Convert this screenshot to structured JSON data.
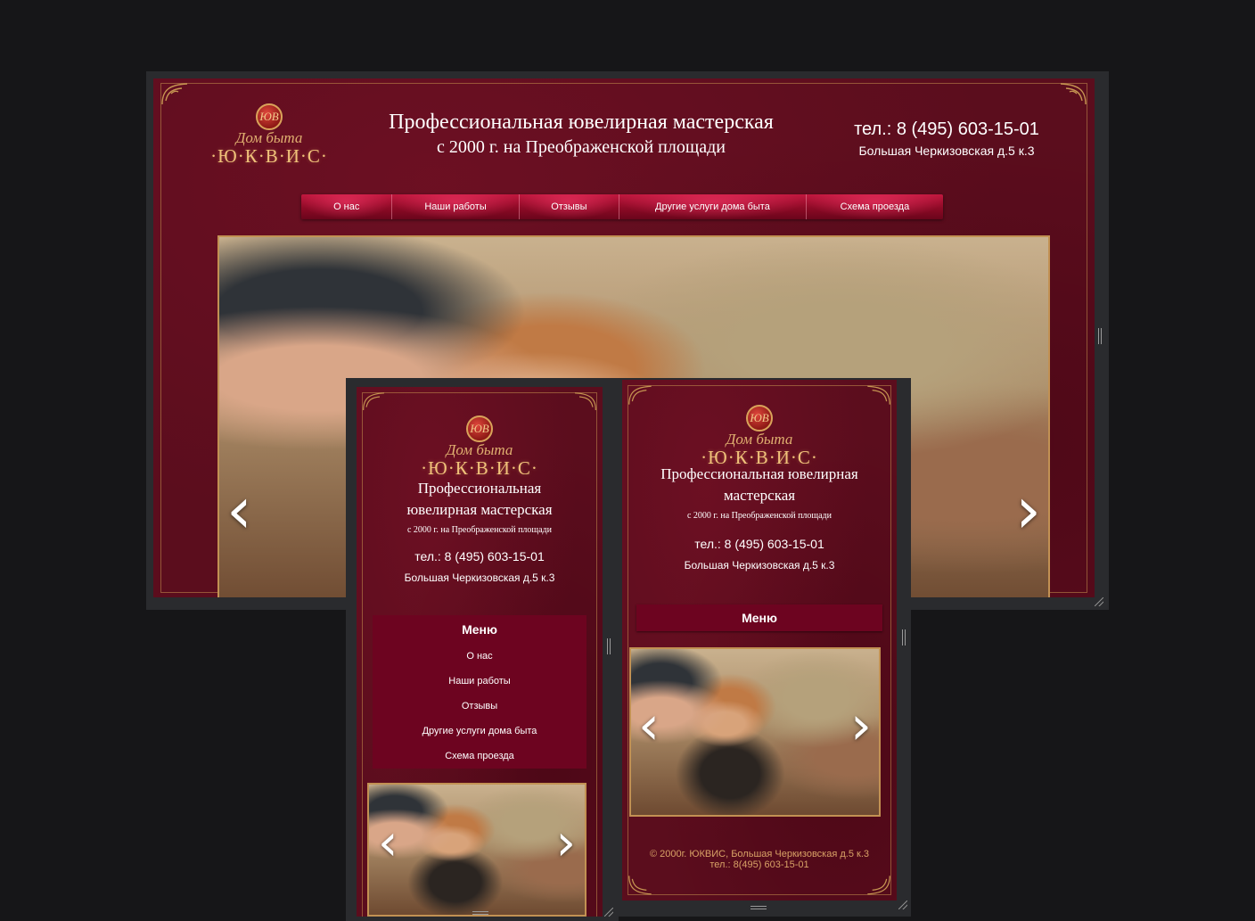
{
  "logo": {
    "emblem": "ЮВ",
    "script": "Дом быта",
    "brand": "·Ю·К·В·И·С·"
  },
  "desktop": {
    "title_line1": "Профессиональная ювелирная мастерская",
    "title_line2": "с 2000 г. на Преображенской площади",
    "phone": "тел.: 8 (495) 603-15-01",
    "address": "Большая Черкизовская д.5 к.3",
    "nav": [
      "О нас",
      "Наши работы",
      "Отзывы",
      "Другие услуги дома быта",
      "Схема проезда"
    ],
    "arrow_prev": "‹",
    "arrow_next": "›"
  },
  "mobile_narrow": {
    "title": "Профессиональная ювелирная мастерская",
    "subtitle": "с 2000 г. на Преображенской площади",
    "phone": "тел.: 8 (495) 603-15-01",
    "address": "Большая Черкизовская д.5 к.3",
    "menu_title": "Меню",
    "menu_items": [
      "О нас",
      "Наши работы",
      "Отзывы",
      "Другие услуги дома быта",
      "Схема проезда"
    ],
    "arrow_prev": "‹",
    "arrow_next": "›"
  },
  "mobile_wide": {
    "title": "Профессиональная ювелирная мастерская",
    "subtitle": "с 2000 г. на Преображенской площади",
    "phone": "тел.: 8 (495) 603-15-01",
    "address": "Большая Черкизовская д.5 к.3",
    "menu_button": "Меню",
    "arrow_prev": "‹",
    "arrow_next": "›",
    "footer_line1": "© 2000г. ЮКВИС, Большая Черкизовская д.5 к.3",
    "footer_line2": "тел.: 8(495) 603-15-01"
  },
  "colors": {
    "background": "#161618",
    "page": "#5b0d1d",
    "menu": "#6d0420",
    "gold": "#c29153"
  }
}
